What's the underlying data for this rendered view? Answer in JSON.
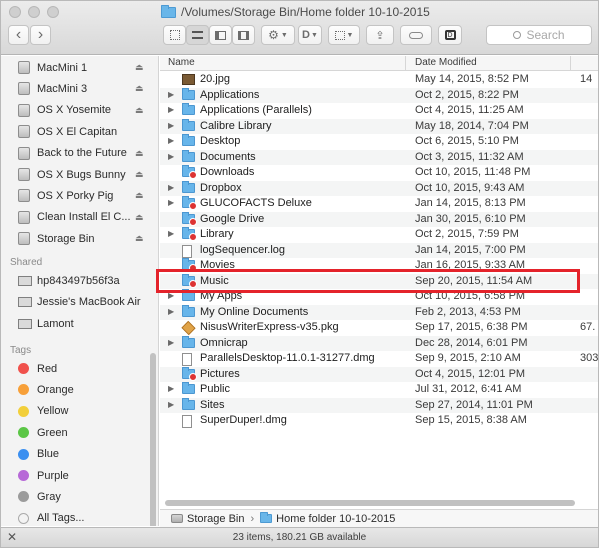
{
  "window": {
    "title": "/Volumes/Storage Bin/Home folder 10-10-2015"
  },
  "toolbar": {
    "back": "‹",
    "forward": "›",
    "search_placeholder": "Search"
  },
  "sidebar": {
    "devices": [
      {
        "label": "MacMini 1",
        "eject": true
      },
      {
        "label": "MacMini 3",
        "eject": true
      },
      {
        "label": "OS X Yosemite",
        "eject": true
      },
      {
        "label": "OS X El Capitan",
        "eject": false
      },
      {
        "label": "Back to the Future",
        "eject": true
      },
      {
        "label": "OS X Bugs Bunny",
        "eject": true
      },
      {
        "label": "OS X Porky Pig",
        "eject": true
      },
      {
        "label": "Clean Install El C...",
        "eject": true
      },
      {
        "label": "Storage Bin",
        "eject": true
      }
    ],
    "shared_heading": "Shared",
    "shared": [
      {
        "label": "hp843497b56f3a"
      },
      {
        "label": "Jessie's MacBook Air"
      },
      {
        "label": "Lamont"
      }
    ],
    "tags_heading": "Tags",
    "tags": [
      {
        "label": "Red",
        "color": "#f0514c"
      },
      {
        "label": "Orange",
        "color": "#f7a039"
      },
      {
        "label": "Yellow",
        "color": "#f2cf3a"
      },
      {
        "label": "Green",
        "color": "#5bc646"
      },
      {
        "label": "Blue",
        "color": "#3b8ff0"
      },
      {
        "label": "Purple",
        "color": "#b769d7"
      },
      {
        "label": "Gray",
        "color": "#9b9b9b"
      },
      {
        "label": "All Tags...",
        "color": ""
      }
    ]
  },
  "list": {
    "columns": {
      "name": "Name",
      "date": "Date Modified"
    },
    "rows": [
      {
        "name": "20.jpg",
        "date": "May 14, 2015, 8:52 PM",
        "size": "14",
        "kind": "image",
        "expand": false
      },
      {
        "name": "Applications",
        "date": "Oct 2, 2015, 8:22 PM",
        "size": "",
        "kind": "folder",
        "expand": true
      },
      {
        "name": "Applications (Parallels)",
        "date": "Oct 4, 2015, 11:25 AM",
        "size": "",
        "kind": "folder",
        "expand": true
      },
      {
        "name": "Calibre Library",
        "date": "May 18, 2014, 7:04 PM",
        "size": "",
        "kind": "folder",
        "expand": true
      },
      {
        "name": "Desktop",
        "date": "Oct 6, 2015, 5:10 PM",
        "size": "",
        "kind": "folder",
        "expand": true
      },
      {
        "name": "Documents",
        "date": "Oct 3, 2015, 11:32 AM",
        "size": "",
        "kind": "folder",
        "expand": true
      },
      {
        "name": "Downloads",
        "date": "Oct 10, 2015, 11:48 PM",
        "size": "",
        "kind": "folder-red",
        "expand": false
      },
      {
        "name": "Dropbox",
        "date": "Oct 10, 2015, 9:43 AM",
        "size": "",
        "kind": "folder",
        "expand": true
      },
      {
        "name": "GLUCOFACTS Deluxe",
        "date": "Jan 14, 2015, 8:13 PM",
        "size": "",
        "kind": "folder-red",
        "expand": true
      },
      {
        "name": "Google Drive",
        "date": "Jan 30, 2015, 6:10 PM",
        "size": "",
        "kind": "folder-red",
        "expand": false
      },
      {
        "name": "Library",
        "date": "Oct 2, 2015, 7:59 PM",
        "size": "",
        "kind": "folder-red",
        "expand": true
      },
      {
        "name": "logSequencer.log",
        "date": "Jan 14, 2015, 7:00 PM",
        "size": "",
        "kind": "doc",
        "expand": false
      },
      {
        "name": "Movies",
        "date": "Jan 16, 2015, 9:33 AM",
        "size": "",
        "kind": "folder-red",
        "expand": false
      },
      {
        "name": "Music",
        "date": "Sep 20, 2015, 11:54 AM",
        "size": "",
        "kind": "folder-red",
        "expand": false
      },
      {
        "name": "My Apps",
        "date": "Oct 10, 2015, 6:58 PM",
        "size": "",
        "kind": "folder",
        "expand": true
      },
      {
        "name": "My Online Documents",
        "date": "Feb 2, 2013, 4:53 PM",
        "size": "",
        "kind": "folder",
        "expand": true
      },
      {
        "name": "NisusWriterExpress-v35.pkg",
        "date": "Sep 17, 2015, 6:38 PM",
        "size": "67.",
        "kind": "pkg",
        "expand": false
      },
      {
        "name": "Omnicrap",
        "date": "Dec 28, 2014, 6:01 PM",
        "size": "",
        "kind": "folder",
        "expand": true
      },
      {
        "name": "ParallelsDesktop-11.0.1-31277.dmg",
        "date": "Sep 9, 2015, 2:10 AM",
        "size": "303.",
        "kind": "doc",
        "expand": false
      },
      {
        "name": "Pictures",
        "date": "Oct 4, 2015, 12:01 PM",
        "size": "",
        "kind": "folder-red",
        "expand": false
      },
      {
        "name": "Public",
        "date": "Jul 31, 2012, 6:41 AM",
        "size": "",
        "kind": "folder",
        "expand": true
      },
      {
        "name": "Sites",
        "date": "Sep 27, 2014, 11:01 PM",
        "size": "",
        "kind": "folder",
        "expand": true
      },
      {
        "name": "SuperDuper!.dmg",
        "date": "Sep 15, 2015, 8:38 AM",
        "size": "",
        "kind": "doc",
        "expand": false
      }
    ]
  },
  "pathbar": {
    "disk": "Storage Bin",
    "sep": "›",
    "folder": "Home folder 10-10-2015"
  },
  "status": {
    "text": "23 items, 180.21 GB available"
  }
}
